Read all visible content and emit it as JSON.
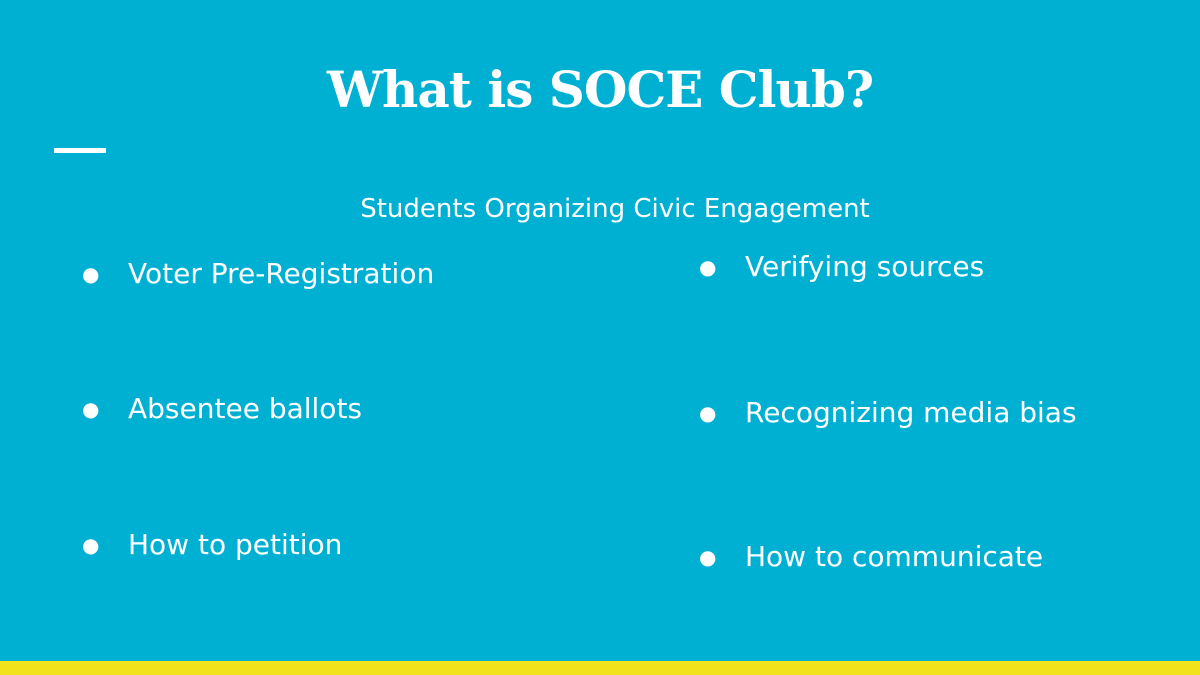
{
  "slide": {
    "title": "What is SOCE Club?",
    "subtitle": "Students Organizing Civic Engagement",
    "bullet_glyph": "●",
    "left_bullets": [
      "Voter Pre-Registration",
      "Absentee ballots",
      "How to petition"
    ],
    "right_bullets": [
      "Verifying sources",
      "Recognizing media bias",
      "How to communicate"
    ]
  },
  "colors": {
    "background": "#00b0d3",
    "text": "#ffffff",
    "bottom_band": "#f2e21c"
  }
}
